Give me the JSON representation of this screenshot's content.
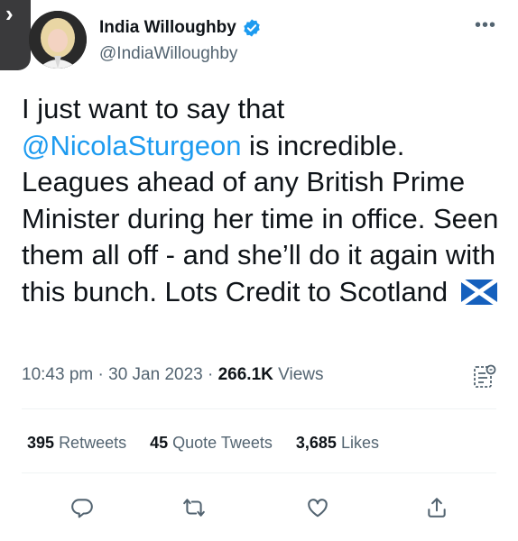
{
  "author": {
    "display_name": "India Willoughby",
    "handle": "@IndiaWilloughby",
    "verified": true
  },
  "tweet": {
    "text_before_mention": "I just want to say that",
    "mention": "@NicolaSturgeon",
    "text_after_mention": " is incredible. Leagues ahead of any British Prime Minister during her time in office. Seen them all off - and she’ll do it again with this bunch. Lots Credit to Scotland"
  },
  "meta": {
    "time": "10:43 pm",
    "date": "30 Jan 2023",
    "separator": "·",
    "views_count": "266.1K",
    "views_label": "Views"
  },
  "stats": {
    "retweets_count": "395",
    "retweets_label": "Retweets",
    "quotes_count": "45",
    "quotes_label": "Quote Tweets",
    "likes_count": "3,685",
    "likes_label": "Likes"
  },
  "icons": {
    "verified": "verified-badge-icon",
    "more": "more-icon",
    "analytics": "analytics-icon",
    "reply": "reply-icon",
    "retweet": "retweet-icon",
    "like": "like-icon",
    "share": "share-icon",
    "flag": "scotland-flag-icon"
  },
  "colors": {
    "accent": "#1d9bf0",
    "text": "#0f1419",
    "secondary": "#536471"
  }
}
